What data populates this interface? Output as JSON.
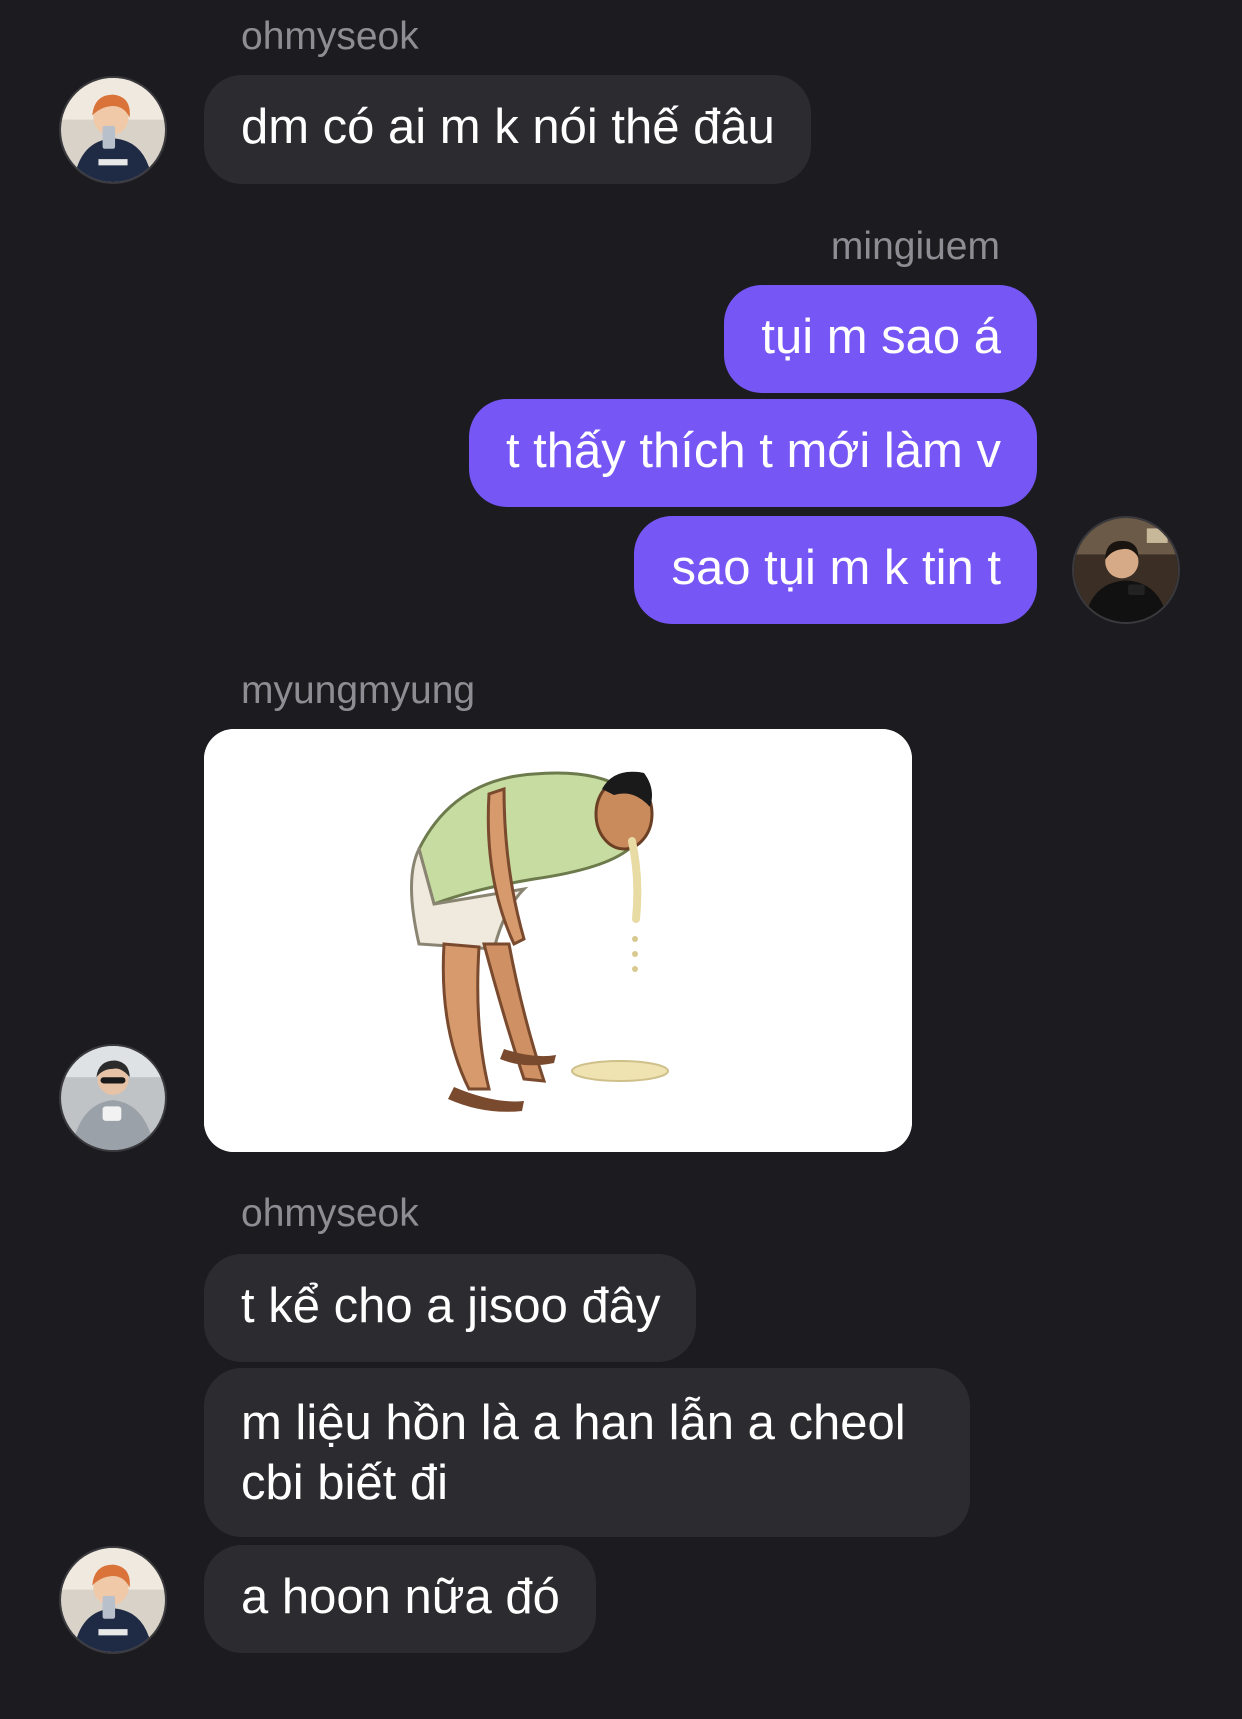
{
  "messages": [
    {
      "sender": "ohmyseok",
      "text": "dm có ai m k nói thế đâu"
    },
    {
      "sender": "mingiuem",
      "texts": [
        "tụi m sao á",
        "t thấy thích t mới làm v",
        "sao tụi m k tin t"
      ]
    },
    {
      "sender": "myungmyung",
      "image": "man-bending-over-vomiting-illustration"
    },
    {
      "sender": "ohmyseok",
      "texts": [
        "t kể cho a jisoo đây",
        "m liệu hồn là a han lẫn a cheol",
        "cbi biết đi",
        "a hoon nữa đó"
      ]
    }
  ],
  "colors": {
    "background": "#1c1b20",
    "incoming_bubble": "#2c2c30",
    "outgoing_bubble": "#7657f5",
    "sender_name": "#8e8d93",
    "text": "#ffffff"
  }
}
